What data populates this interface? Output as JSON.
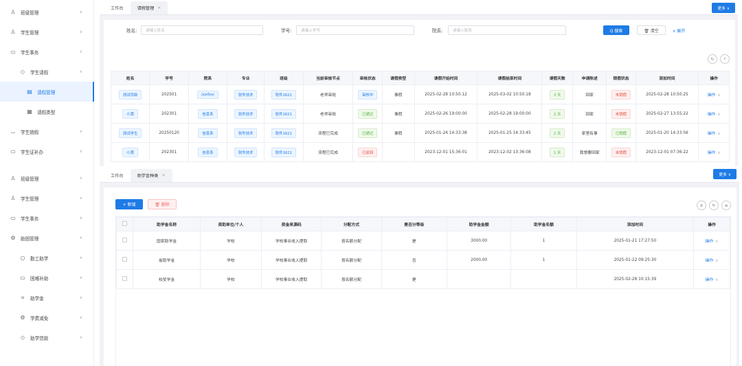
{
  "top": {
    "sidebar": {
      "items": [
        {
          "label": "班级管理",
          "icon": "class-icon"
        },
        {
          "label": "学生管理",
          "icon": "student-icon"
        },
        {
          "label": "学生事务",
          "icon": "affairs-icon"
        },
        {
          "label": "学生请假",
          "icon": "leave-icon"
        },
        {
          "label": "请假管理",
          "icon": "leave-manage-icon"
        },
        {
          "label": "请假类型",
          "icon": "leave-type-icon"
        },
        {
          "label": "学生销假",
          "icon": "cancel-leave-icon"
        },
        {
          "label": "学生证补办",
          "icon": "card-icon"
        }
      ]
    },
    "tabs": {
      "home": "工作台",
      "current": "请假管理",
      "close": "×"
    },
    "more": "更多 ∨",
    "search": {
      "name_label": "姓名:",
      "name_placeholder": "请输入姓名",
      "id_label": "学号:",
      "id_placeholder": "请输入学号",
      "dept_label": "院系:",
      "dept_placeholder": "请输入院系",
      "search_btn": "Q 搜索",
      "clear_btn": "🗑 清空",
      "expand": "∨ 展开"
    },
    "table": {
      "headers": [
        "姓名",
        "学号",
        "院系",
        "专业",
        "班级",
        "当前审核节点",
        "审核状态",
        "请假类型",
        "请假开始时间",
        "请假结束时间",
        "请假天数",
        "申请陈述",
        "销假状态",
        "添加时间",
        "操作"
      ],
      "rows": [
        {
          "name": "测试岱新",
          "id": "202501",
          "dept": "jsjxfjxy",
          "major": "软件技术",
          "class": "软件1621",
          "node": "老师审批",
          "status": "审核中",
          "status_color": "blue",
          "type": "事假",
          "start": "2025-02-28 10:50:12",
          "end": "2025-03-02 10:50:18",
          "days": "3 天",
          "reason": "回家",
          "cancel": "未销假",
          "cancel_color": "red",
          "added": "2025-02-28 10:50:25",
          "op": "操作"
        },
        {
          "name": "小黄",
          "id": "202301",
          "dept": "信息系",
          "major": "软件技术",
          "class": "软件1621",
          "node": "老师审批",
          "status": "已通过",
          "status_color": "green",
          "type": "事假",
          "start": "2025-02-26 19:00:00",
          "end": "2025-02-28 19:00:00",
          "days": "2 天",
          "reason": "回家",
          "cancel": "未销假",
          "cancel_color": "red",
          "added": "2025-02-27 13:55:22",
          "op": "操作"
        },
        {
          "name": "测试学生",
          "id": "20250120",
          "dept": "信息系",
          "major": "软件技术",
          "class": "软件1621",
          "node": "流程已完成",
          "status": "已通过",
          "status_color": "green",
          "type": "事假",
          "start": "2025-01-24 14:33:38",
          "end": "2025-01-25 14:33:45",
          "days": "2 天",
          "reason": "家里有事",
          "cancel": "已销假",
          "cancel_color": "green",
          "added": "2025-01-20 14:33:56",
          "op": "操作"
        },
        {
          "name": "小黄",
          "id": "202301",
          "dept": "信息系",
          "major": "软件技术",
          "class": "软件1621",
          "node": "流程已完成",
          "status": "已驳回",
          "status_color": "red",
          "type": "",
          "start": "2023-12-01 15:36:01",
          "end": "2023-12-02 13:36:08",
          "days": "1 天",
          "reason": "我想要回家",
          "cancel": "未销假",
          "cancel_color": "red",
          "added": "2023-12-01 07:36:22",
          "op": "操作"
        }
      ]
    }
  },
  "bottom": {
    "sidebar": {
      "items": [
        {
          "label": "班级管理",
          "icon": "class-icon"
        },
        {
          "label": "学生管理",
          "icon": "student-icon"
        },
        {
          "label": "学生事务",
          "icon": "affairs-icon"
        },
        {
          "label": "助困管理",
          "icon": "aid-icon"
        },
        {
          "label": "勤工助学",
          "icon": "work-study-icon"
        },
        {
          "label": "困难补助",
          "icon": "subsidy-icon"
        },
        {
          "label": "助学金",
          "icon": "grant-icon"
        },
        {
          "label": "学费减免",
          "icon": "fee-waiver-icon"
        },
        {
          "label": "助学贷款",
          "icon": "loan-icon"
        }
      ]
    },
    "tabs": {
      "home": "工作台",
      "current": "助学金种类",
      "close": "×"
    },
    "more": "更多 ∨",
    "toolbar": {
      "add": "+ 新增",
      "delete": "🗑 删除"
    },
    "table": {
      "headers": [
        "",
        "助学金名称",
        "资助单位/个人",
        "资金来源码",
        "分配方式",
        "是否分等级",
        "助学金金额",
        "助学金名额",
        "添加时间",
        "操作"
      ],
      "rows": [
        {
          "name": "国家助学金",
          "sponsor": "学校",
          "source": "学校事业收入提取",
          "method": "按名额分配",
          "graded": "是",
          "amount": "3000.00",
          "quota": "1",
          "added": "2025-01-21 17:27:50",
          "op": "操作"
        },
        {
          "name": "省助学金",
          "sponsor": "学校",
          "source": "学校事业收入提取",
          "method": "按名额分配",
          "graded": "否",
          "amount": "2000.00",
          "quota": "1",
          "added": "2025-01-22 09:25:30",
          "op": "操作"
        },
        {
          "name": "校奖学金",
          "sponsor": "学校",
          "source": "学校事业收入提取",
          "method": "按名额分配",
          "graded": "是",
          "amount": "",
          "quota": "",
          "added": "2025-02-28 10:15:39",
          "op": "操作"
        }
      ]
    }
  }
}
